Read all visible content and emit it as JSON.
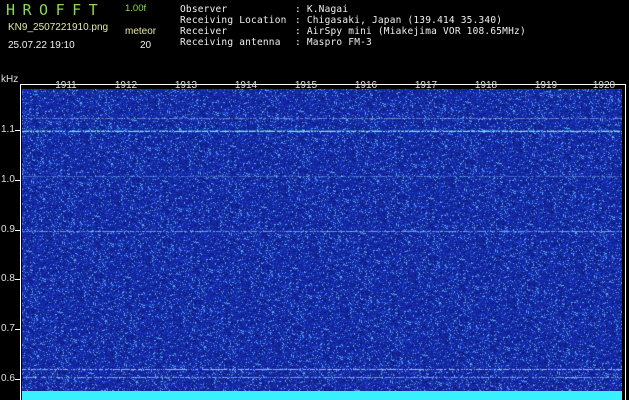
{
  "header": {
    "brand": "HROFFT",
    "version": "1.00f",
    "filename": "KN9_2507221910.png",
    "datetime": "25.07.22 19:10",
    "meteor_label": "meteor",
    "meteor_count": "20",
    "info_rows": [
      {
        "label": "Observer",
        "value": ": K.Nagai"
      },
      {
        "label": "Receiving Location",
        "value": ": Chigasaki, Japan (139.414 35.340)"
      },
      {
        "label": "Receiver",
        "value": ": AirSpy mini (Miakejima VOR 108.65MHz)"
      },
      {
        "label": "Receiving antenna",
        "value": ": Maspro FM-3"
      }
    ]
  },
  "axes": {
    "y_unit": "kHz",
    "y_ticks": [
      "1.1",
      "1.0",
      "0.9",
      "0.8",
      "0.7",
      "0.6"
    ],
    "x_ticks": [
      "1911",
      "1912",
      "1913",
      "1914",
      "1915",
      "1916",
      "1917",
      "1918",
      "1919",
      "1920"
    ]
  },
  "colors": {
    "background": "#000000",
    "plot_base": "#1f3fae",
    "signal_line": "#7ff0e0",
    "bottom_bar": "#39f0ff",
    "header_green": "#8cd94a"
  }
}
